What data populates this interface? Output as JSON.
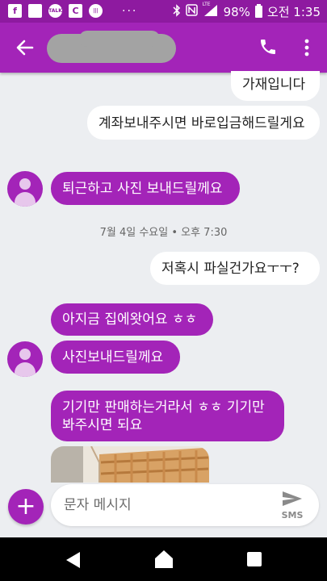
{
  "status_bar": {
    "icons": [
      "facebook-icon",
      "square-app-icon",
      "kakaotalk-icon",
      "nfc-app-icon",
      "barcode-icon"
    ],
    "kakaotalk_label": "TALK",
    "more_dots": "···",
    "signal_label": "LTE",
    "battery": "98%",
    "time": "오전 1:35"
  },
  "header": {
    "contact_name_redacted": true
  },
  "messages": [
    {
      "direction": "out",
      "text": "가재입니다"
    },
    {
      "direction": "out",
      "text": "계좌보내주시면 바로입금해드릴게요"
    },
    {
      "direction": "in",
      "text": "퇴근하고 사진 보내드릴께요"
    },
    {
      "direction": "timestamp",
      "text": "7월 4일 수요일 • 오후 7:30"
    },
    {
      "direction": "out",
      "text": "저혹시 파실건가요ㅜㅜ?"
    },
    {
      "direction": "in",
      "text": "아지금 집에왓어요 ㅎㅎ"
    },
    {
      "direction": "in",
      "text": "사진보내드릴께요"
    },
    {
      "direction": "in",
      "text": "기기만 판매하는거라서 ㅎㅎ 기기만 봐주시면 되요"
    }
  ],
  "compose": {
    "placeholder": "문자 메시지",
    "send_label": "SMS"
  },
  "colors": {
    "accent": "#a324b8",
    "status_bar": "#8e1aa0",
    "background": "#eceef1"
  }
}
